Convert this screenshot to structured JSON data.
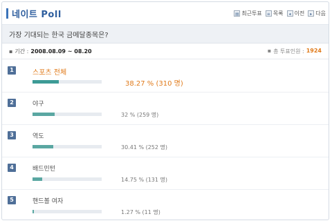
{
  "header": {
    "title": "네이트 Poll",
    "toolbar": [
      {
        "icon": "recent-poll-icon",
        "label": "최근투표"
      },
      {
        "icon": "list-icon",
        "label": "목록"
      },
      {
        "icon": "prev-icon",
        "label": "이전"
      },
      {
        "icon": "next-icon",
        "label": "다음"
      }
    ]
  },
  "question": "가장 기대되는 한국 금메달종목은?",
  "period": {
    "label": "기간 :",
    "value": "2008.08.09 ~ 08.20"
  },
  "participants": {
    "label": "총 투표인원 :",
    "value": "1924"
  },
  "options": [
    {
      "number": "1",
      "label": "스포츠 전체",
      "percent_text": "38.27 % (310 명)",
      "percent": 38.27
    },
    {
      "number": "2",
      "label": "야구",
      "percent_text": "32 % (259 명)",
      "percent": 32
    },
    {
      "number": "3",
      "label": "역도",
      "percent_text": "30.41 % (252 명)",
      "percent": 30.41
    },
    {
      "number": "4",
      "label": "배드민턴",
      "percent_text": "14.75 % (131 명)",
      "percent": 14.75
    },
    {
      "number": "5",
      "label": "핸드볼 여자",
      "percent_text": "1.27 % (11 명)",
      "percent": 1.27
    }
  ],
  "colors": {
    "accent": "#3b73b9",
    "highlight": "#e07a1a",
    "bar": "#5aa7a2"
  }
}
